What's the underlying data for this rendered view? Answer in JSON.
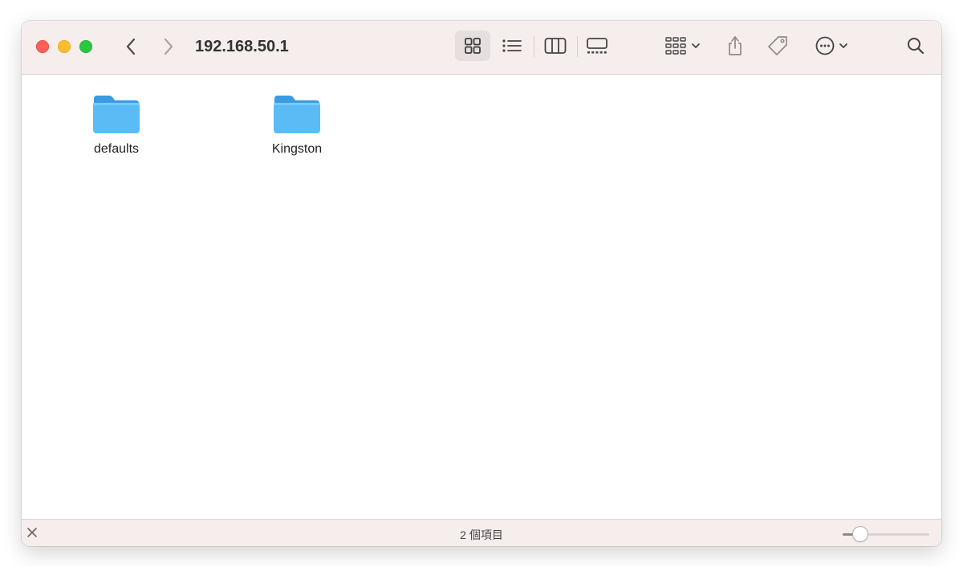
{
  "window": {
    "title": "192.168.50.1"
  },
  "toolbar": {
    "view_modes": [
      "icon-view",
      "list-view",
      "column-view",
      "gallery-view"
    ],
    "selected_view": "icon-view",
    "buttons": [
      "back",
      "forward",
      "group-by",
      "share",
      "tags",
      "more-actions",
      "search"
    ]
  },
  "files": [
    {
      "name": "defaults",
      "kind": "folder"
    },
    {
      "name": "Kingston",
      "kind": "folder"
    }
  ],
  "status": {
    "item_count_text": "2 個項目",
    "zoom_level": 0.2
  },
  "colors": {
    "folder_blue": "#5bbcf5",
    "folder_tab": "#3a9ae2",
    "chrome_bg": "#f6eeed"
  }
}
